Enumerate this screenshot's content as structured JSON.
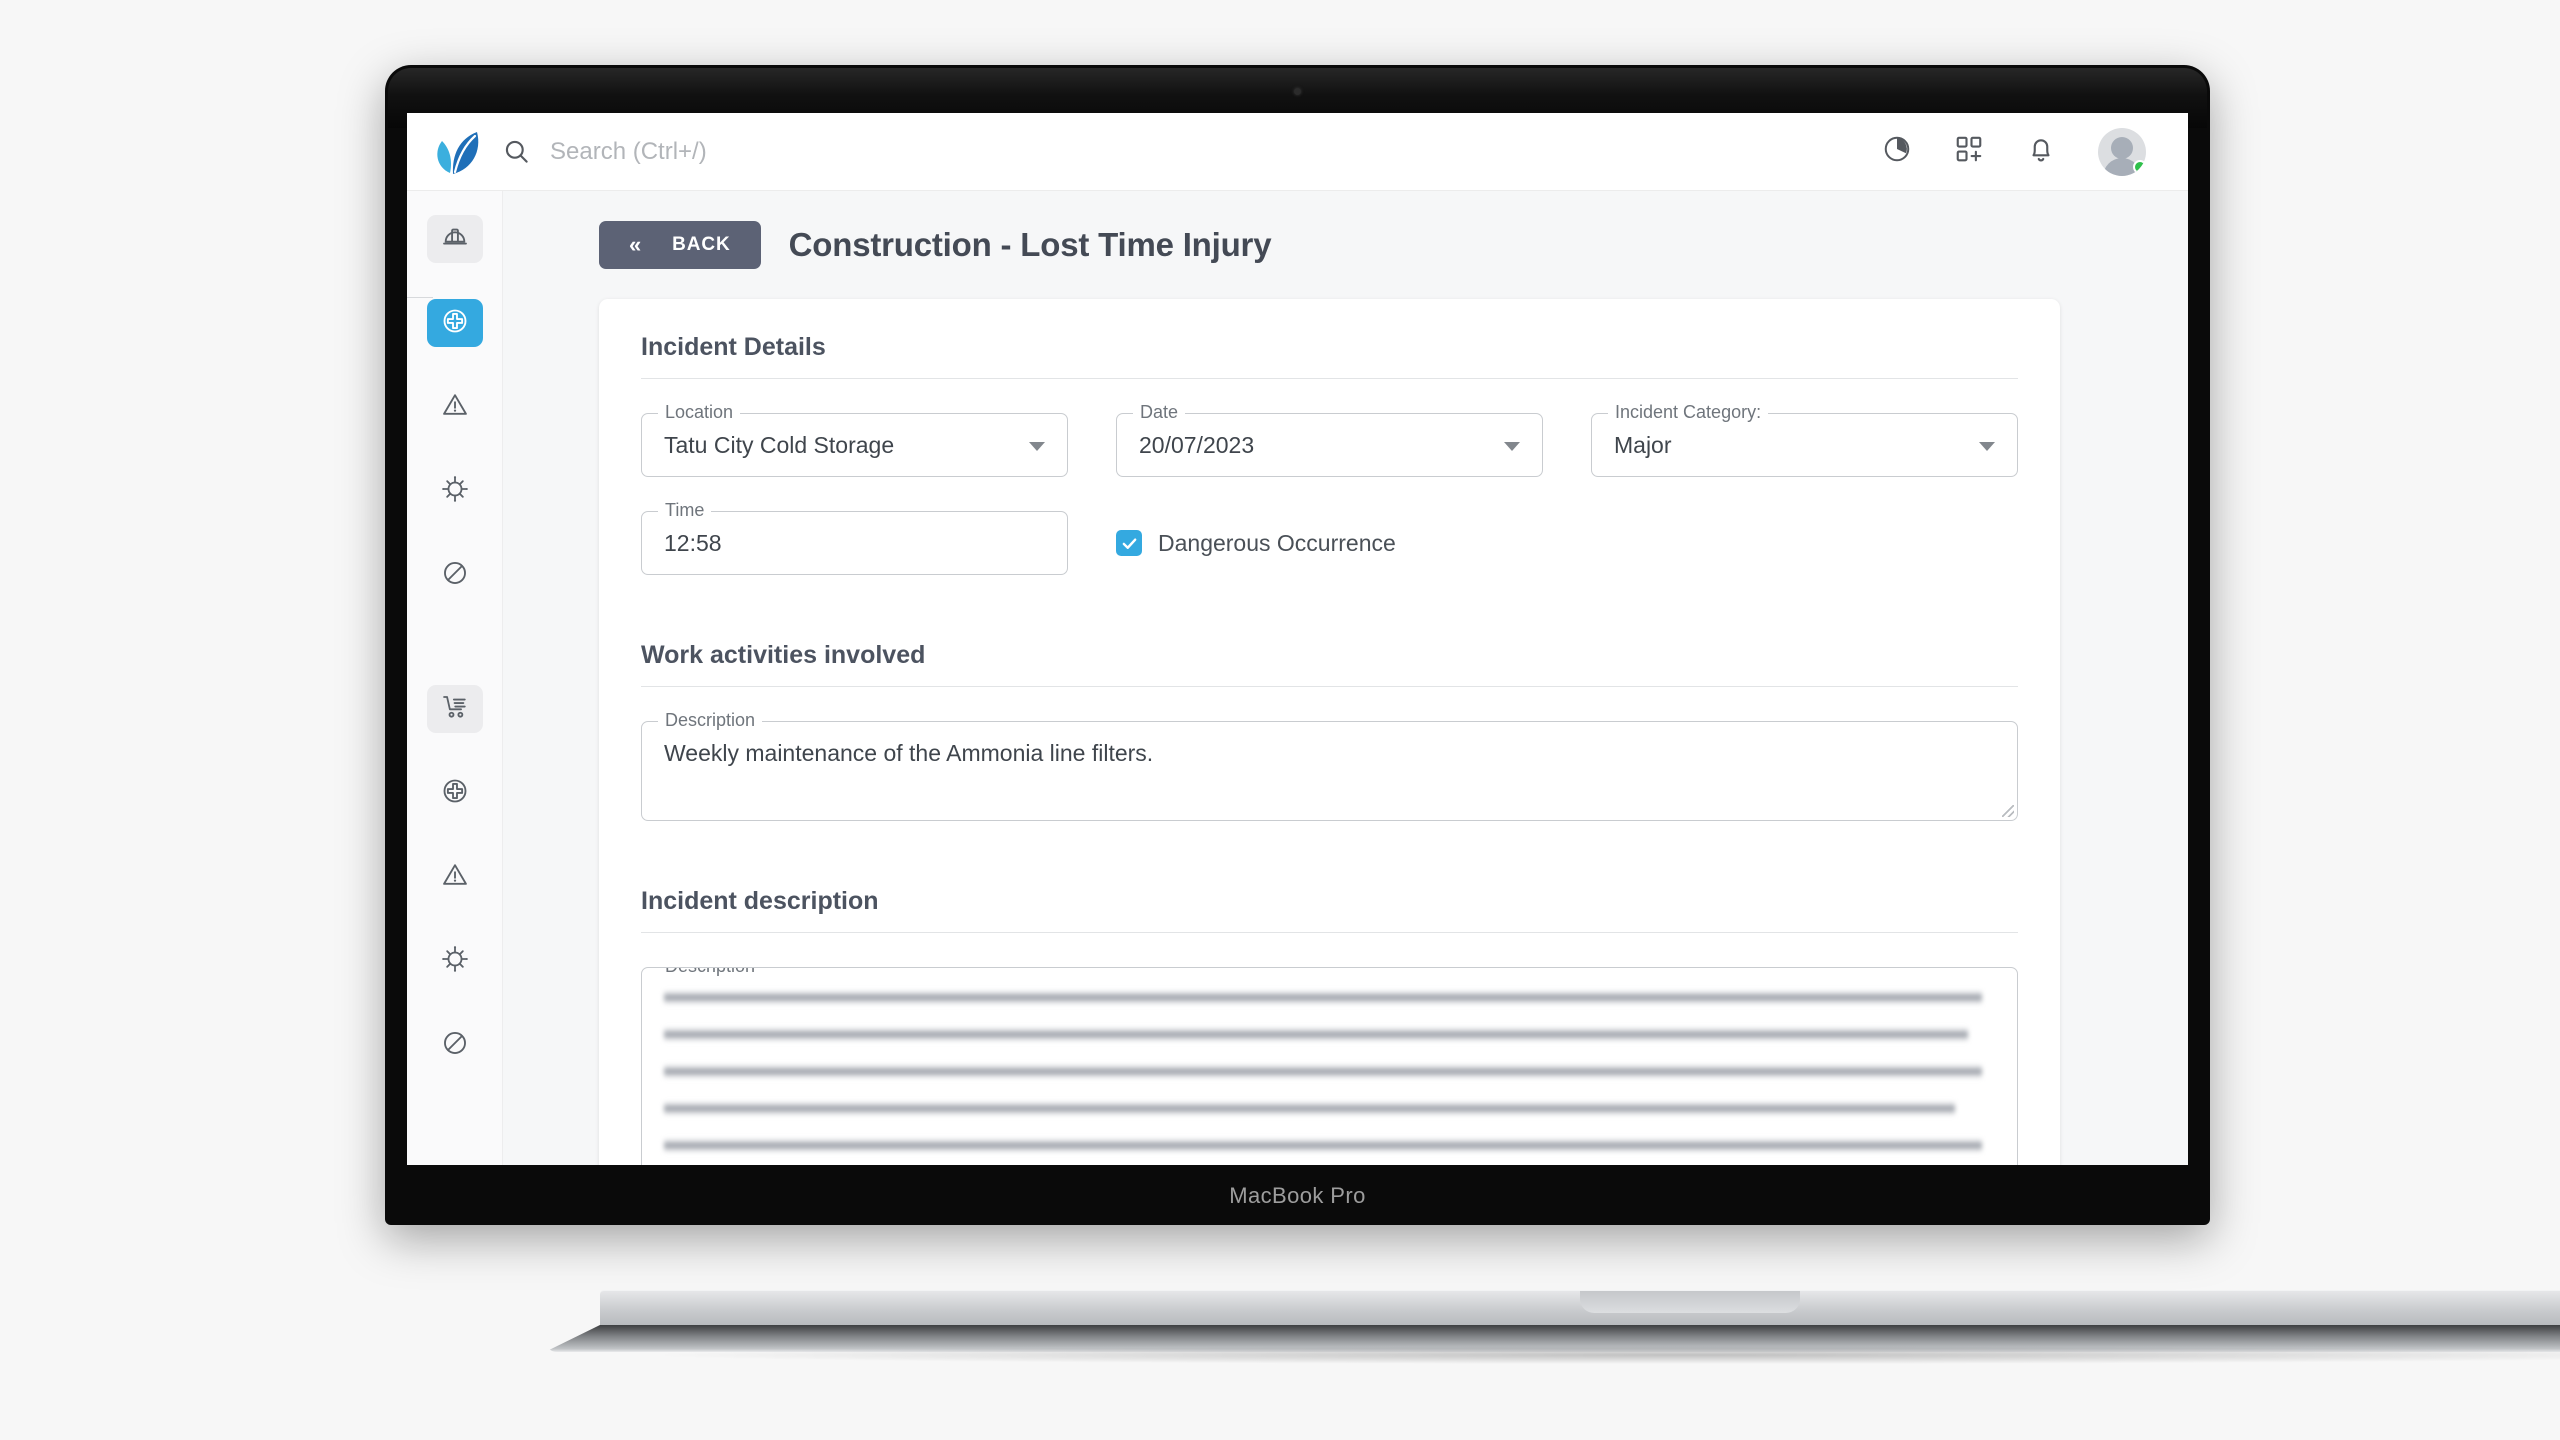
{
  "device": {
    "label": "MacBook Pro"
  },
  "brand": {
    "logo_icon": "leaf-logo-icon",
    "leaf_light": "#3BAFDE",
    "leaf_dark": "#1F6FB8"
  },
  "search": {
    "placeholder": "Search (Ctrl+/)",
    "value": "",
    "icon": "search-icon"
  },
  "topbar": {
    "actions": [
      {
        "icon": "pie-chart-clock-icon",
        "name": "reports"
      },
      {
        "icon": "grid-plus-icon",
        "name": "apps-add"
      },
      {
        "icon": "bell-icon",
        "name": "notifications"
      }
    ],
    "avatar": {
      "icon": "avatar",
      "status": "online",
      "status_color": "#2fc04b"
    }
  },
  "sidebar": {
    "groups": [
      {
        "items": [
          {
            "icon": "hard-hat-icon",
            "name": "sidebar-item-safety",
            "state": "highlight"
          },
          {
            "icon": "medical-cross-icon",
            "name": "sidebar-item-health",
            "state": "active"
          },
          {
            "icon": "warning-triangle-icon",
            "name": "sidebar-item-hazards",
            "state": "default"
          },
          {
            "icon": "virus-icon",
            "name": "sidebar-item-biohazard",
            "state": "default"
          },
          {
            "icon": "prohibition-icon",
            "name": "sidebar-item-restrictions",
            "state": "default"
          }
        ]
      },
      {
        "items": [
          {
            "icon": "shopping-cart-icon",
            "name": "sidebar-item-procurement",
            "state": "highlight"
          },
          {
            "icon": "medical-cross-icon",
            "name": "sidebar-item-health-2",
            "state": "default"
          },
          {
            "icon": "warning-triangle-icon",
            "name": "sidebar-item-hazards-2",
            "state": "default"
          },
          {
            "icon": "virus-icon",
            "name": "sidebar-item-biohazard-2",
            "state": "default"
          },
          {
            "icon": "prohibition-icon",
            "name": "sidebar-item-restrictions-2",
            "state": "default"
          }
        ]
      }
    ]
  },
  "page": {
    "back_label": "BACK",
    "back_icon": "double-chevron-left-icon",
    "title": "Construction - Lost Time Injury"
  },
  "form": {
    "incident_details": {
      "heading": "Incident Details",
      "location": {
        "label": "Location",
        "value": "Tatu City Cold Storage"
      },
      "date": {
        "label": "Date",
        "value": "20/07/2023"
      },
      "category": {
        "label": "Incident Category:",
        "value": "Major"
      },
      "time": {
        "label": "Time",
        "value": "12:58"
      },
      "dangerous_occurrence": {
        "label": "Dangerous Occurrence",
        "checked": true
      }
    },
    "work_activities": {
      "heading": "Work activities involved",
      "description": {
        "label": "Description",
        "value": "Weekly maintenance of the Ammonia line filters."
      }
    },
    "incident_description": {
      "heading": "Incident description",
      "description": {
        "label": "Description",
        "value": "",
        "redacted": true,
        "redacted_line_count": 7
      }
    }
  },
  "colors": {
    "accent": "#34a9e0",
    "button": "#5c6275",
    "text": "#4a5057",
    "page_bg": "#f6f7f8"
  }
}
